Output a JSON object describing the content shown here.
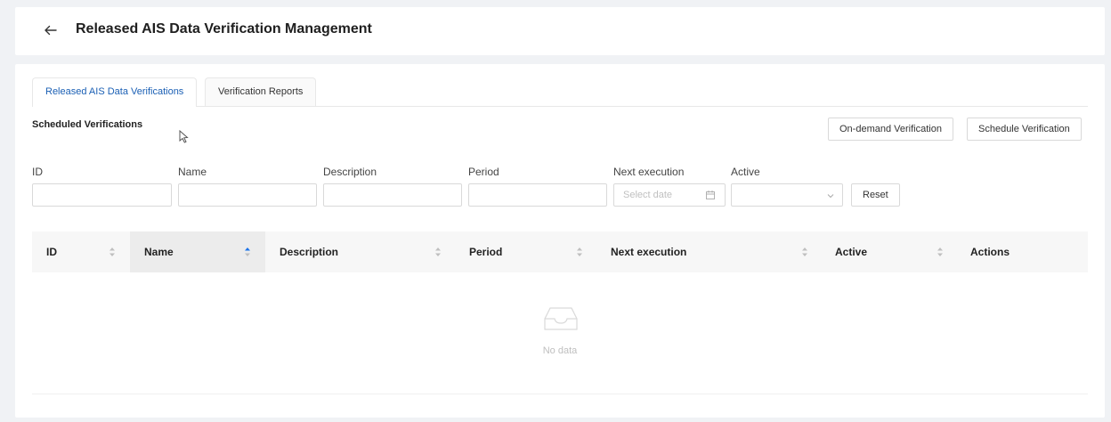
{
  "header": {
    "back_icon": "arrow-left-icon",
    "title": "Released AIS Data Verification Management"
  },
  "tabs": [
    {
      "label": "Released AIS Data Verifications",
      "active": true
    },
    {
      "label": "Verification Reports",
      "active": false
    }
  ],
  "section": {
    "title": "Scheduled Verifications"
  },
  "actions": {
    "on_demand": "On-demand Verification",
    "schedule": "Schedule Verification"
  },
  "filters": {
    "id_label": "ID",
    "name_label": "Name",
    "description_label": "Description",
    "period_label": "Period",
    "next_execution_label": "Next execution",
    "next_execution_placeholder": "Select date",
    "active_label": "Active",
    "reset": "Reset"
  },
  "table": {
    "columns": [
      {
        "label": "ID",
        "sortable": true
      },
      {
        "label": "Name",
        "sortable": true,
        "sorted": "ascending"
      },
      {
        "label": "Description",
        "sortable": true
      },
      {
        "label": "Period",
        "sortable": true
      },
      {
        "label": "Next execution",
        "sortable": true
      },
      {
        "label": "Active",
        "sortable": true
      },
      {
        "label": "Actions",
        "sortable": false
      }
    ],
    "empty_text": "No data"
  },
  "colors": {
    "accent": "#1a5fb4",
    "background": "#f0f2f5",
    "header_row": "#f7f7f7"
  }
}
